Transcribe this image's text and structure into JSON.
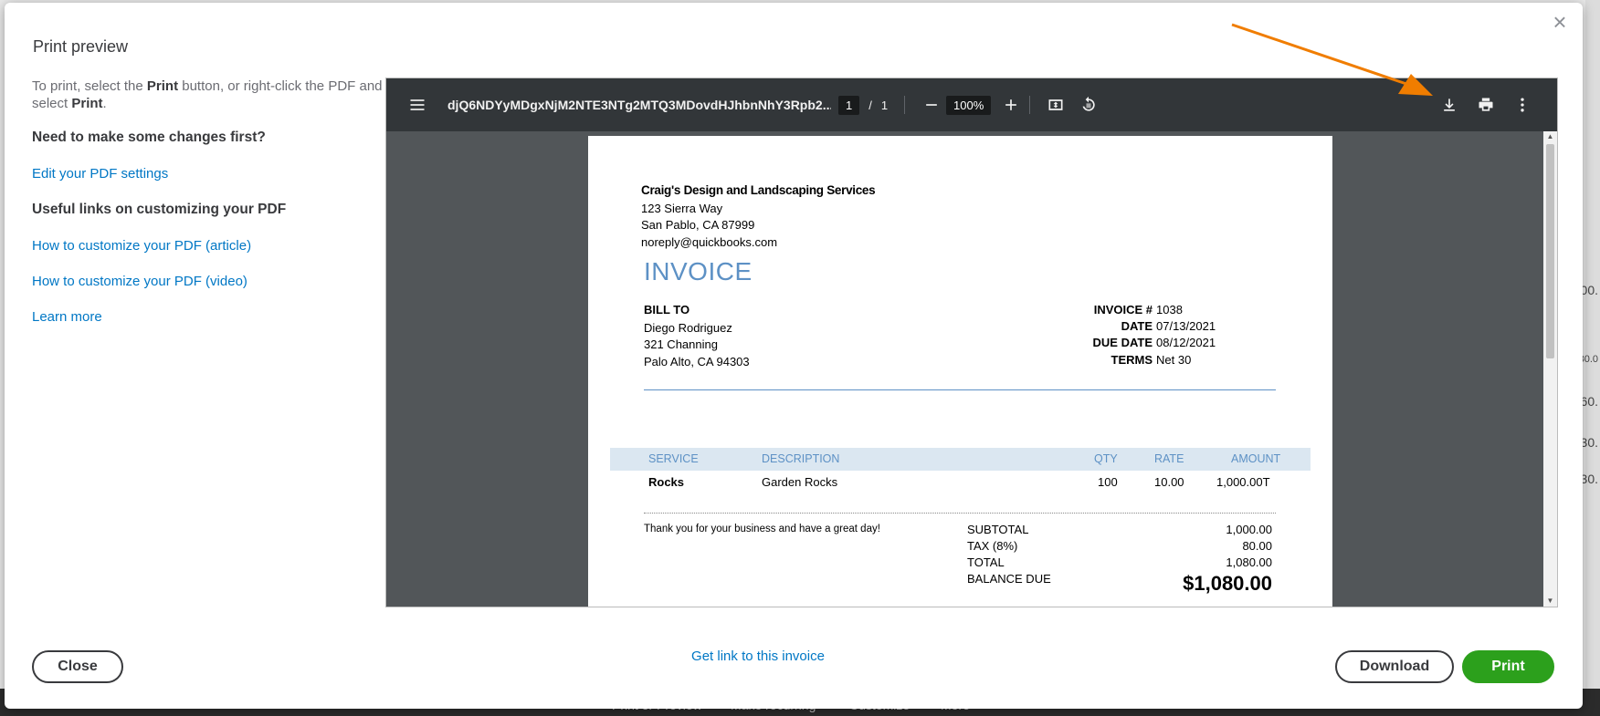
{
  "background": {
    "bottom_bar_items": [
      "Print or Preview",
      "Make recurring",
      "Customize",
      "More"
    ],
    "right_fragments": [
      "00.",
      "30.0",
      "60.",
      "30.",
      "30."
    ]
  },
  "modal": {
    "title": "Print preview",
    "close_glyph": "×"
  },
  "sidebar": {
    "intro_prefix": "To print, select the ",
    "intro_print1": "Print",
    "intro_mid": " button, or right-click the PDF and select ",
    "intro_print2": "Print",
    "intro_suffix": ".",
    "heading_changes": "Need to make some changes first?",
    "link_edit": "Edit your PDF settings",
    "heading_links": "Useful links on customizing your PDF",
    "link_article": "How to customize your PDF (article)",
    "link_video": "How to customize your PDF (video)",
    "link_learn": "Learn more"
  },
  "viewer": {
    "file_name": "djQ6NDYyMDgxNjM2NTE3NTg2MTQ3MDovdHJhbnNhY3Rpb2...",
    "page_current": "1",
    "page_sep": "/",
    "page_total": "1",
    "zoom": "100%"
  },
  "invoice": {
    "company": "Craig's Design and Landscaping Services",
    "address1": "123 Sierra Way",
    "address2": "San Pablo, CA  87999",
    "email": "noreply@quickbooks.com",
    "title": "INVOICE",
    "bill_to_label": "BILL TO",
    "bill_to": [
      "Diego Rodriguez",
      "321 Channing",
      "Palo Alto, CA  94303"
    ],
    "meta": [
      {
        "label": "INVOICE #",
        "value": "1038"
      },
      {
        "label": "DATE",
        "value": "07/13/2021"
      },
      {
        "label": "DUE DATE",
        "value": "08/12/2021"
      },
      {
        "label": "TERMS",
        "value": "Net 30"
      }
    ],
    "columns": {
      "service": "SERVICE",
      "description": "DESCRIPTION",
      "qty": "QTY",
      "rate": "RATE",
      "amount": "AMOUNT"
    },
    "rows": [
      {
        "service": "Rocks",
        "description": "Garden Rocks",
        "qty": "100",
        "rate": "10.00",
        "amount": "1,000.00T"
      }
    ],
    "thanks": "Thank you for your business and have a great day!",
    "totals": [
      {
        "label": "SUBTOTAL",
        "value": "1,000.00"
      },
      {
        "label": "TAX (8%)",
        "value": "80.00"
      },
      {
        "label": "TOTAL",
        "value": "1,080.00"
      }
    ],
    "balance_label": "BALANCE DUE",
    "balance_value": "$1,080.00",
    "accent_color": "#5d91c5"
  },
  "footer": {
    "close_label": "Close",
    "get_link_label": "Get link to this invoice",
    "download_label": "Download",
    "print_label": "Print"
  },
  "colors": {
    "primary": "#2ca01c",
    "link": "#0077c5",
    "annotation_arrow": "#f07d00"
  }
}
